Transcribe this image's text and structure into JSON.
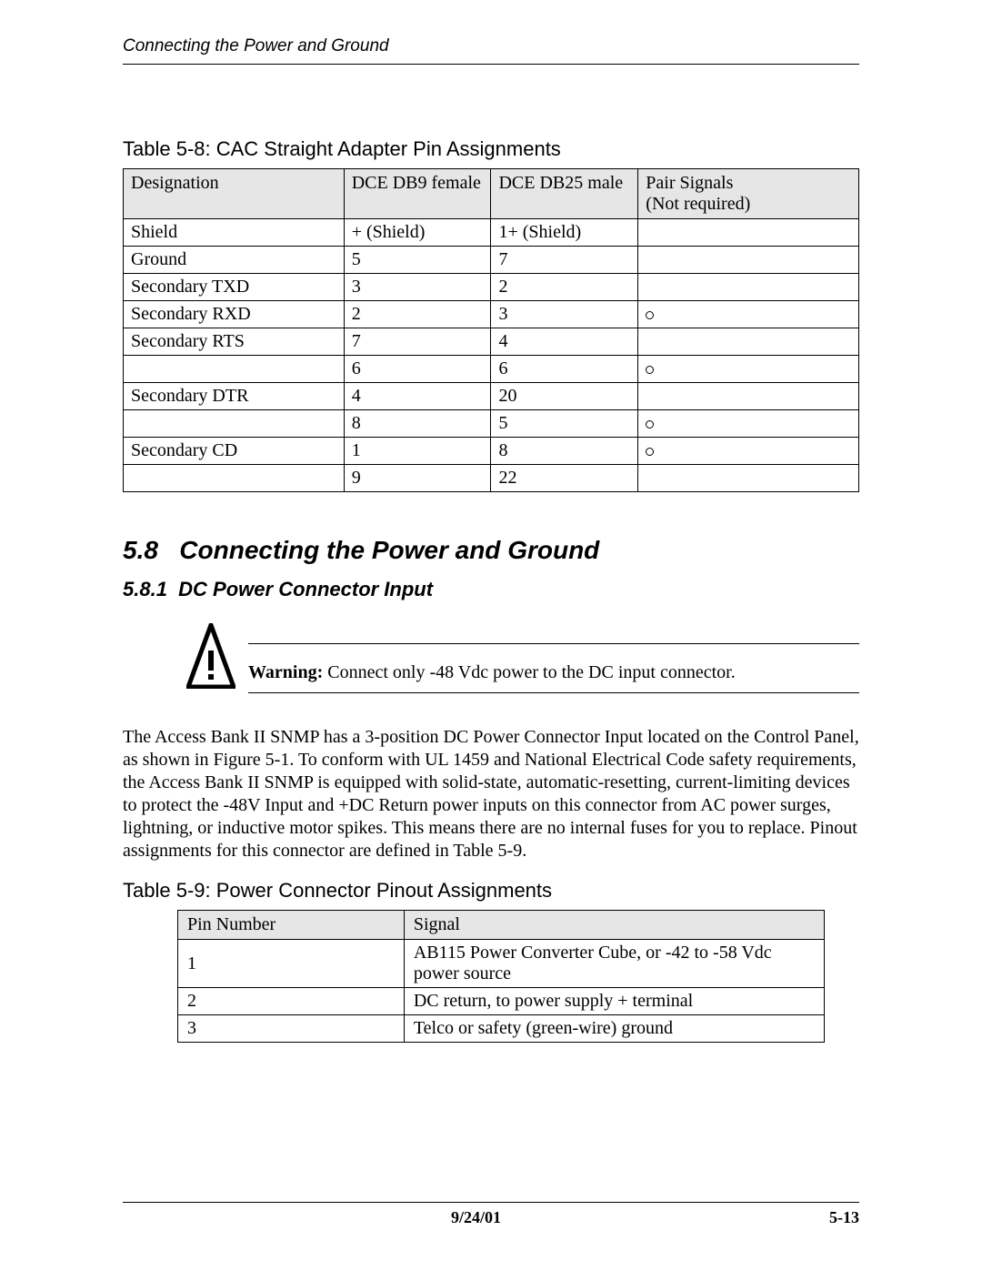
{
  "header": {
    "running_title": "Connecting the Power and Ground"
  },
  "table1": {
    "caption": "Table 5-8: CAC Straight Adapter Pin Assignments",
    "headers": {
      "c1": "Designation",
      "c2": "DCE DB9 female",
      "c3": "DCE DB25 male",
      "c4a": "Pair Signals",
      "c4b": "(Not required)"
    },
    "rows": [
      {
        "c1": "Shield",
        "c2": "+ (Shield)",
        "c3": "1+ (Shield)",
        "mark": false
      },
      {
        "c1": "Ground",
        "c2": "5",
        "c3": "7",
        "mark": false
      },
      {
        "c1": "Secondary TXD",
        "c2": "3",
        "c3": "2",
        "mark": false
      },
      {
        "c1": "Secondary RXD",
        "c2": "2",
        "c3": "3",
        "mark": true
      },
      {
        "c1": "Secondary RTS",
        "c2": "7",
        "c3": "4",
        "mark": false
      },
      {
        "c1": "",
        "c2": "6",
        "c3": "6",
        "mark": true
      },
      {
        "c1": "Secondary DTR",
        "c2": "4",
        "c3": "20",
        "mark": false
      },
      {
        "c1": "",
        "c2": "8",
        "c3": "5",
        "mark": true
      },
      {
        "c1": "Secondary CD",
        "c2": "1",
        "c3": "8",
        "mark": true
      },
      {
        "c1": "",
        "c2": "9",
        "c3": "22",
        "mark": false
      }
    ]
  },
  "section": {
    "num": "5.8",
    "title": "Connecting the Power and Ground"
  },
  "subsection": {
    "num": "5.8.1",
    "title": "DC Power Connector Input"
  },
  "warning": {
    "label": "Warning:",
    "text": "  Connect only -48 Vdc power to the DC input connector."
  },
  "paragraph": "The Access Bank II SNMP has a 3-position DC Power Connector Input located on the Control Panel, as shown in Figure 5-1. To conform with UL 1459 and National Electrical Code safety requirements, the Access Bank II SNMP is equipped with solid-state, automatic-resetting, current-limiting devices to protect the -48V Input and +DC Return power inputs on this connector from AC power surges, lightning, or inductive motor spikes. This means there are no internal fuses for you to replace. Pinout assignments for this connector are defined in Table 5-9.",
  "table2": {
    "caption": "Table 5-9: Power Connector Pinout Assignments",
    "headers": {
      "c1": "Pin Number",
      "c2": "Signal"
    },
    "rows": [
      {
        "c1": "1",
        "c2": "AB115 Power Converter Cube, or -42 to -58 Vdc power source"
      },
      {
        "c1": "2",
        "c2": "DC return, to power supply + terminal"
      },
      {
        "c1": "3",
        "c2": "Telco or safety (green-wire) ground"
      }
    ]
  },
  "footer": {
    "date": "9/24/01",
    "page": "5-13"
  }
}
